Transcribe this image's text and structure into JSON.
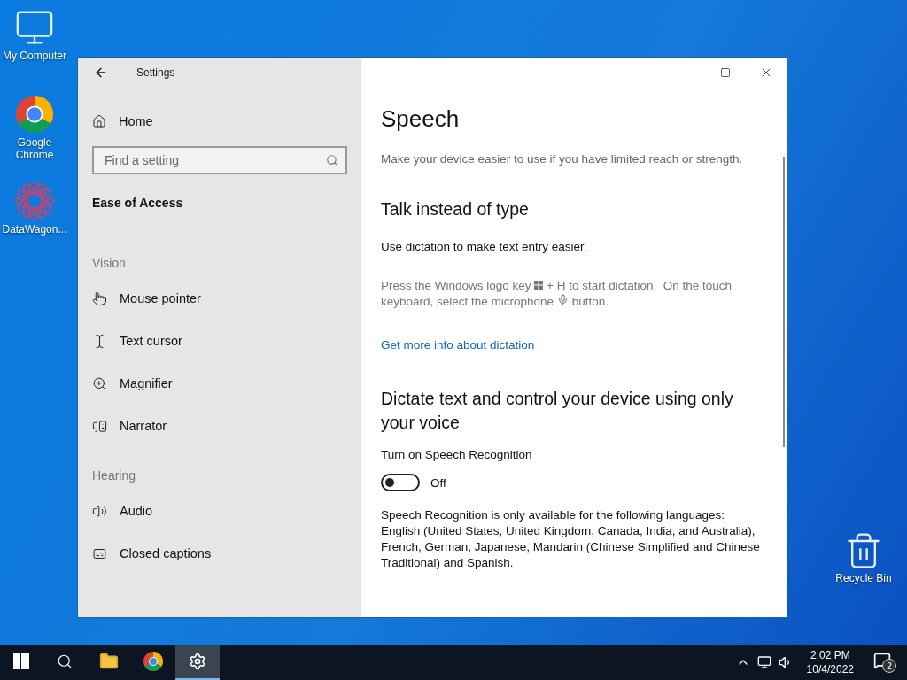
{
  "desktop_icons": [
    {
      "label": "My Computer"
    },
    {
      "label": "Google Chrome"
    },
    {
      "label": "DataWagon..."
    },
    {
      "label": "Recycle Bin"
    }
  ],
  "window": {
    "title": "Settings"
  },
  "sidebar": {
    "home": "Home",
    "search": {
      "placeholder": "Find a setting"
    },
    "category": "Ease of Access",
    "groups": [
      {
        "heading": "Vision",
        "items": [
          {
            "label": "Mouse pointer"
          },
          {
            "label": "Text cursor"
          },
          {
            "label": "Magnifier"
          },
          {
            "label": "Narrator"
          }
        ]
      },
      {
        "heading": "Hearing",
        "items": [
          {
            "label": "Audio"
          },
          {
            "label": "Closed captions"
          }
        ]
      }
    ]
  },
  "content": {
    "title": "Speech",
    "intro": "Make your device easier to use if you have limited reach or strength.",
    "sections": [
      {
        "heading": "Talk instead of type",
        "text": "Use dictation to make text entry easier.",
        "hint_before_key": "Press the Windows logo key",
        "hint_after_key": "+ H to start dictation.  On the touch",
        "hint_line_two": "keyboard, select the microphone",
        "hint_end": "button.",
        "link": "Get more info about dictation"
      },
      {
        "heading": "Dictate text and control your device using only your voice",
        "toggle": {
          "label": "Turn on Speech Recognition",
          "on": false,
          "state_text": "Off"
        },
        "text": "Speech Recognition is only available for the following languages: English (United States, United Kingdom, Canada, India, and Australia), French, German, Japanese, Mandarin (Chinese Simplified and Chinese Traditional) and Spanish."
      }
    ]
  },
  "taskbar": {
    "apps": [
      {
        "selected": false
      },
      {
        "selected": false
      },
      {
        "selected": false
      },
      {
        "selected": false
      },
      {
        "selected": true
      }
    ],
    "time": "2:02 PM",
    "date": "10/4/2022",
    "notifications": "2"
  }
}
